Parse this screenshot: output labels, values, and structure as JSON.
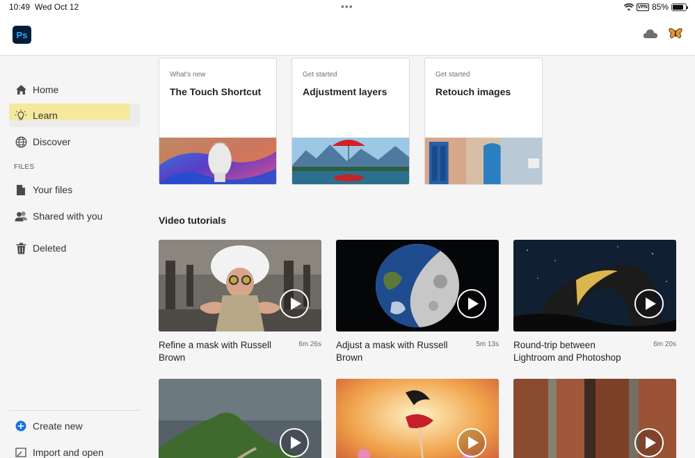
{
  "status": {
    "time": "10:49",
    "date": "Wed Oct 12",
    "vpn": "VPN",
    "battery": "85%",
    "battery_level": 0.85
  },
  "header": {
    "logo": "Ps",
    "cloud_icon": "cloud-icon",
    "profile_icon": "butterfly-icon"
  },
  "sidebar": {
    "items": [
      {
        "label": "Home",
        "icon": "home-icon"
      },
      {
        "label": "Learn",
        "icon": "lightbulb-icon",
        "active": true
      },
      {
        "label": "Discover",
        "icon": "globe-icon"
      }
    ],
    "files_label": "FILES",
    "file_items": [
      {
        "label": "Your files",
        "icon": "file-icon"
      },
      {
        "label": "Shared with you",
        "icon": "shared-users-icon"
      },
      {
        "label": "Deleted",
        "icon": "trash-icon"
      }
    ],
    "bottom_items": [
      {
        "label": "Create new",
        "icon": "plus-circle-icon"
      },
      {
        "label": "Import and open",
        "icon": "import-icon"
      }
    ]
  },
  "cards": [
    {
      "kicker": "What's new",
      "title": "The Touch Shortcut"
    },
    {
      "kicker": "Get started",
      "title": "Adjustment layers"
    },
    {
      "kicker": "Get started",
      "title": "Retouch images"
    }
  ],
  "video_section_title": "Video tutorials",
  "videos": [
    {
      "title": "Refine a mask with Russell Brown",
      "duration": "6m 26s"
    },
    {
      "title": "Adjust a mask with Russell Brown",
      "duration": "5m 13s"
    },
    {
      "title": "Round-trip between Lightroom and Photoshop",
      "duration": "6m 20s"
    },
    {
      "title": "",
      "duration": ""
    },
    {
      "title": "",
      "duration": ""
    },
    {
      "title": "",
      "duration": ""
    }
  ],
  "colors": {
    "ps_bg": "#001e36",
    "ps_text": "#31a8ff",
    "highlight": "#f7e98f",
    "create_new": "#1473e6"
  }
}
